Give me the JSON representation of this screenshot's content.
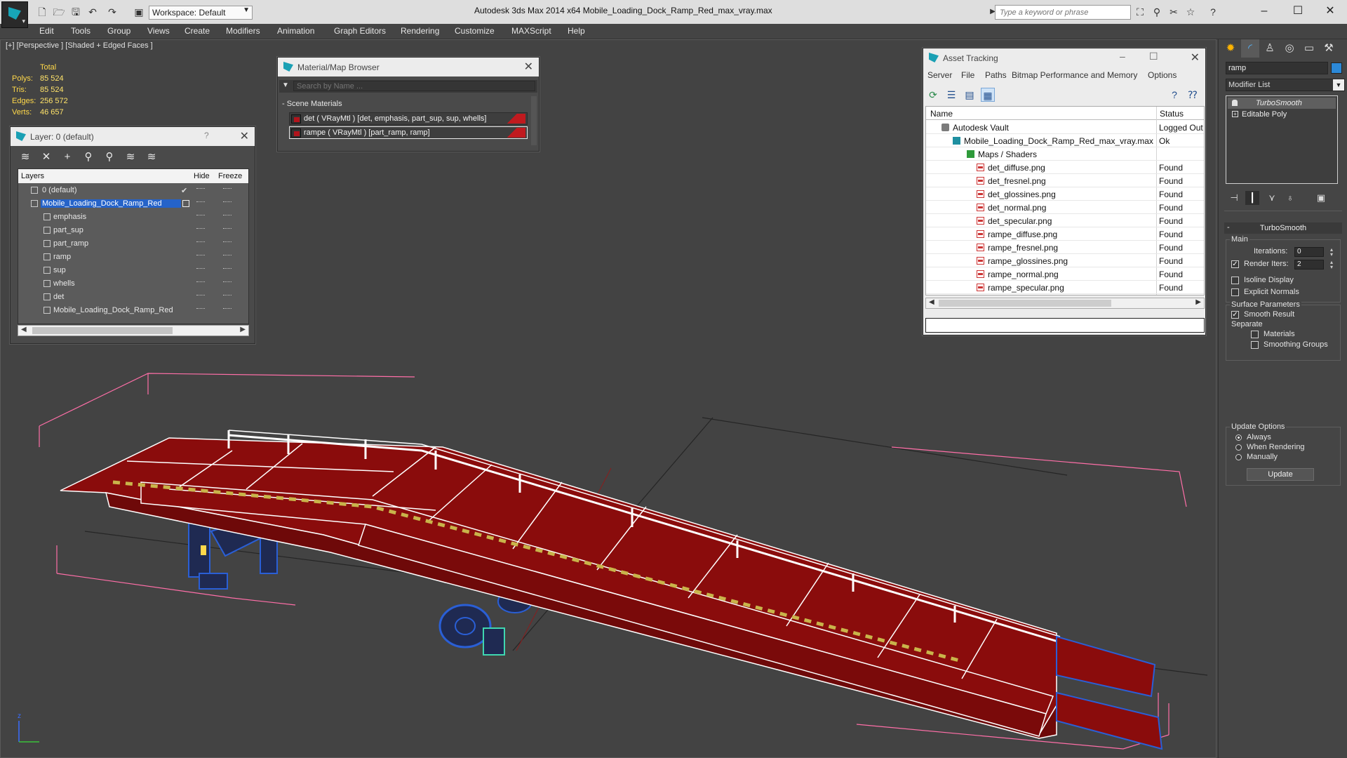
{
  "app": {
    "title": "Autodesk 3ds Max  2014 x64       Mobile_Loading_Dock_Ramp_Red_max_vray.max",
    "workspace": "Workspace: Default",
    "search_placeholder": "Type a keyword or phrase"
  },
  "menu": [
    "Edit",
    "Tools",
    "Group",
    "Views",
    "Create",
    "Modifiers",
    "Animation",
    "Graph Editors",
    "Rendering",
    "Customize",
    "MAXScript",
    "Help"
  ],
  "viewport": {
    "label": "[+] [Perspective ] [Shaded + Edged Faces ]",
    "stats": {
      "header": "Total",
      "polys_label": "Polys:",
      "polys": "85 524",
      "tris_label": "Tris:",
      "tris": "85 524",
      "edges_label": "Edges:",
      "edges": "256 572",
      "verts_label": "Verts:",
      "verts": "46 657"
    },
    "axis_label": "z"
  },
  "layer_panel": {
    "title": "Layer: 0 (default)",
    "help": "?",
    "col_layers": "Layers",
    "col_hide": "Hide",
    "col_freeze": "Freeze",
    "rows": [
      {
        "name": "0 (default)"
      },
      {
        "name": "Mobile_Loading_Dock_Ramp_Red"
      },
      {
        "name": "emphasis"
      },
      {
        "name": "part_sup"
      },
      {
        "name": "part_ramp"
      },
      {
        "name": "ramp"
      },
      {
        "name": "sup"
      },
      {
        "name": "whells"
      },
      {
        "name": "det"
      },
      {
        "name": "Mobile_Loading_Dock_Ramp_Red"
      }
    ]
  },
  "material_browser": {
    "title": "Material/Map Browser",
    "search_placeholder": "Search by Name ...",
    "section": "- Scene Materials",
    "materials": [
      {
        "label": "det  ( VRayMtl ) [det, emphasis, part_sup, sup, whells]"
      },
      {
        "label": "rampe  ( VRayMtl ) [part_ramp, ramp]"
      }
    ]
  },
  "asset_tracking": {
    "title": "Asset Tracking",
    "menu": [
      "Server",
      "File",
      "Paths",
      "Bitmap Performance and Memory",
      "Options"
    ],
    "col_name": "Name",
    "col_status": "Status",
    "rows": [
      {
        "name": "Autodesk Vault",
        "status": "Logged Out",
        "icon": "vault"
      },
      {
        "name": "Mobile_Loading_Dock_Ramp_Red_max_vray.max",
        "status": "Ok",
        "icon": "max"
      },
      {
        "name": "Maps / Shaders",
        "status": "",
        "icon": "maps"
      },
      {
        "name": "det_diffuse.png",
        "status": "Found",
        "icon": "png"
      },
      {
        "name": "det_fresnel.png",
        "status": "Found",
        "icon": "png"
      },
      {
        "name": "det_glossines.png",
        "status": "Found",
        "icon": "png"
      },
      {
        "name": "det_normal.png",
        "status": "Found",
        "icon": "png"
      },
      {
        "name": "det_specular.png",
        "status": "Found",
        "icon": "png"
      },
      {
        "name": "rampe_diffuse.png",
        "status": "Found",
        "icon": "png"
      },
      {
        "name": "rampe_fresnel.png",
        "status": "Found",
        "icon": "png"
      },
      {
        "name": "rampe_glossines.png",
        "status": "Found",
        "icon": "png"
      },
      {
        "name": "rampe_normal.png",
        "status": "Found",
        "icon": "png"
      },
      {
        "name": "rampe_specular.png",
        "status": "Found",
        "icon": "png"
      }
    ]
  },
  "command_panel": {
    "object_name": "ramp",
    "object_color": "#2c89d8",
    "modifier_list": "Modifier List",
    "stack": [
      {
        "label": "TurboSmooth",
        "active": true
      },
      {
        "label": "Editable Poly",
        "active": false
      }
    ],
    "turbosmooth": {
      "title": "TurboSmooth",
      "main_label": "Main",
      "iterations_label": "Iterations:",
      "iterations": "0",
      "render_iters_label": "Render Iters:",
      "render_iters": "2",
      "render_iters_checked": true,
      "isoline_label": "Isoline Display",
      "explicit_normals_label": "Explicit Normals",
      "surface_params_label": "Surface Parameters",
      "smooth_result_label": "Smooth Result",
      "smooth_result_checked": true,
      "separate_label": "Separate",
      "materials_label": "Materials",
      "smoothing_groups_label": "Smoothing Groups",
      "update_options_label": "Update Options",
      "always_label": "Always",
      "when_rendering_label": "When Rendering",
      "manually_label": "Manually",
      "update_button": "Update"
    }
  },
  "colors": {
    "accent": "#1aa0b4",
    "selection": "#2563c9",
    "ramp_red": "#8a0c0c",
    "wire_white": "#ffffff",
    "support_blue": "#2a5fd6",
    "stat_yellow": "#ffd84a"
  }
}
